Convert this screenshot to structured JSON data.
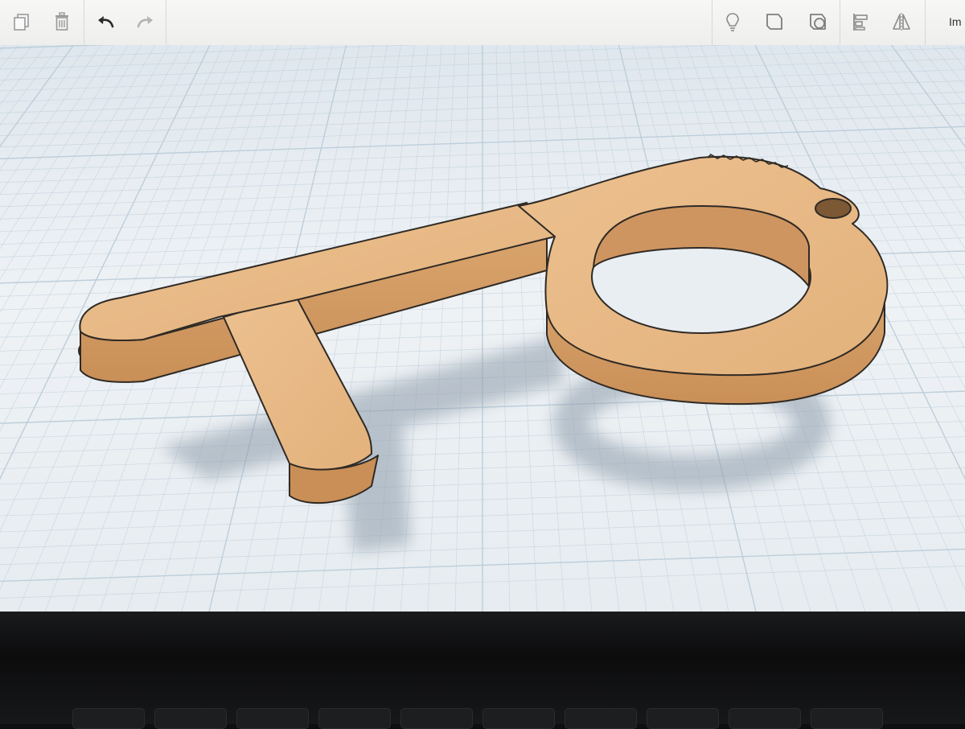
{
  "toolbar": {
    "left_tools": [
      {
        "icon": "copy-icon"
      },
      {
        "icon": "trash-icon"
      },
      {
        "icon": "undo-icon"
      },
      {
        "icon": "redo-icon"
      }
    ],
    "right_tools": [
      {
        "icon": "lightbulb-icon"
      },
      {
        "icon": "solid-shape-icon"
      },
      {
        "icon": "hole-shape-icon"
      },
      {
        "icon": "align-icon"
      },
      {
        "icon": "mirror-icon"
      }
    ],
    "import_label": "Im"
  },
  "model": {
    "name_icon": "keychain-hook-model",
    "color": "#e6b681",
    "shadow_color": "#9aa7b3",
    "outline_color": "#2f2a25"
  },
  "workplane": {
    "grid_color": "#b9cbd8",
    "background": "#e8edf1"
  }
}
